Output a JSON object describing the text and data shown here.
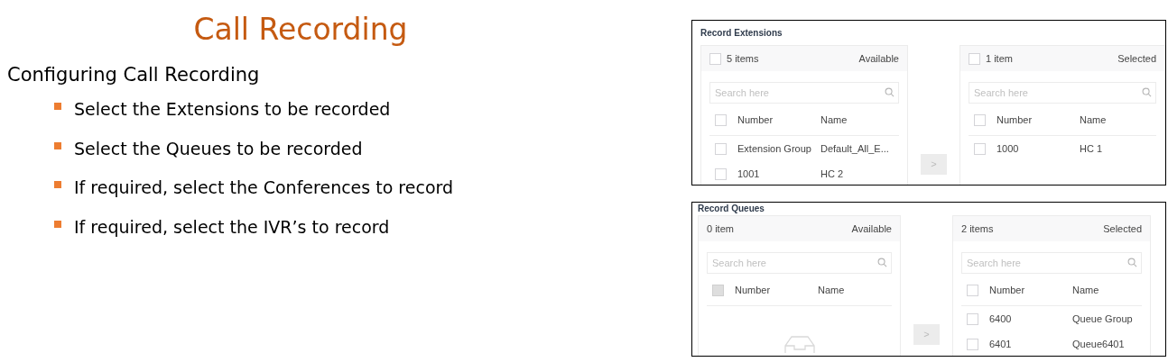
{
  "slide": {
    "title": "Call Recording",
    "subtitle": "Configuring Call Recording",
    "bullets": [
      "Select the Extensions to be recorded",
      "Select the Queues to be recorded",
      "If required, select the Conferences to record",
      "If required, select the IVR’s to record"
    ]
  },
  "transfers": [
    {
      "title": "Record Extensions",
      "move_button": {
        "label": ">",
        "disabled": true
      },
      "available": {
        "count": "5 items",
        "label": "Available",
        "count_checkbox": {
          "checked": false
        },
        "placeholder": "Search here",
        "columns": [
          "Number",
          "Name"
        ],
        "header_checkbox": {
          "checked": false,
          "disabled": false
        },
        "empty": false,
        "rows": [
          {
            "number": "Extension Group",
            "name": "Default_All_E...",
            "checked": false
          },
          {
            "number": "1001",
            "name": "HC 2",
            "checked": false
          }
        ]
      },
      "selected": {
        "count": "1 item",
        "label": "Selected",
        "count_checkbox": {
          "checked": false
        },
        "placeholder": "Search here",
        "columns": [
          "Number",
          "Name"
        ],
        "header_checkbox": {
          "checked": false,
          "disabled": false
        },
        "empty": false,
        "rows": [
          {
            "number": "1000",
            "name": "HC 1",
            "checked": false
          }
        ]
      }
    },
    {
      "title": "Record Queues",
      "move_button": {
        "label": ">",
        "disabled": true
      },
      "available": {
        "count": "0 item",
        "label": "Available",
        "placeholder": "Search here",
        "columns": [
          "Number",
          "Name"
        ],
        "header_checkbox": {
          "checked": false,
          "disabled": true
        },
        "empty": true
      },
      "selected": {
        "count": "2 items",
        "label": "Selected",
        "placeholder": "Search here",
        "columns": [
          "Number",
          "Name"
        ],
        "header_checkbox": {
          "checked": false,
          "disabled": false
        },
        "empty": false,
        "rows": [
          {
            "number": "6400",
            "name": "Queue Group",
            "checked": false
          },
          {
            "number": "6401",
            "name": "Queue6401",
            "checked": false
          }
        ]
      }
    }
  ]
}
